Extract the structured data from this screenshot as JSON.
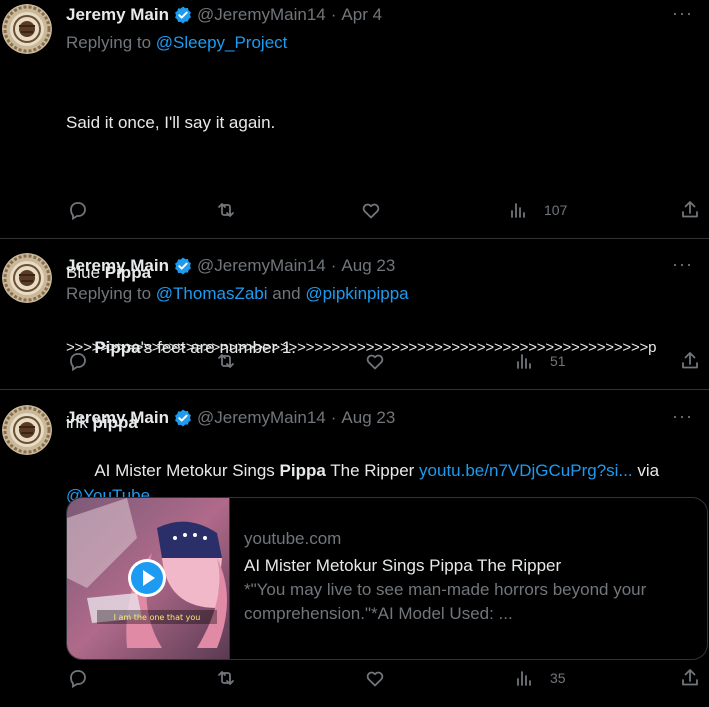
{
  "tweets": [
    {
      "name": "Jeremy Main",
      "handle": "@JeremyMain14",
      "date": "Apr 4",
      "replying_prefix": "Replying to ",
      "replying_to": "@Sleepy_Project",
      "text": {
        "line1": "Said it once, I'll say it again.",
        "blue_prefix": "Blue ",
        "blue_bold": "Pippa",
        "arrows": ">>>>>>>>>>>>>>>>>>>>>>>>>>>>>>>>>>>>>>>>>>>>>>>>>>>>>>>>>>>>>>>>>>>>p",
        "ink_prefix": "ink ",
        "ink_bold": "pippa"
      },
      "views": "107"
    },
    {
      "name": "Jeremy Main",
      "handle": "@JeremyMain14",
      "date": "Aug 23",
      "replying_prefix": "Replying to ",
      "replying_to_1": "@ThomasZabi",
      "replying_and": " and ",
      "replying_to_2": "@pipkinpippa",
      "text": {
        "bold": "Pippa",
        "rest": "'s feet are number 1."
      },
      "views": "51"
    },
    {
      "name": "Jeremy Main",
      "handle": "@JeremyMain14",
      "date": "Aug 23",
      "text": {
        "prefix": "AI Mister Metokur Sings ",
        "bold": "Pippa",
        "suffix": " The Ripper ",
        "link": "youtu.be/n7VDjGCuPrg?si...",
        "via": " via",
        "mention": "@YouTube"
      },
      "card": {
        "domain": "youtube.com",
        "title": "AI Mister Metokur Sings Pippa The Ripper",
        "description": "*\"You may live to see man-made horrors beyond your comprehension.\"*AI Model Used: ...",
        "thumb_caption": "I am the one that you"
      },
      "views": "35"
    }
  ],
  "ui": {
    "more": "···",
    "sep": "·"
  },
  "colors": {
    "background": "#000000",
    "text": "#e7e9ea",
    "muted": "#71767b",
    "link": "#1d9bf0",
    "border": "#2f3336",
    "verified": "#1d9bf0"
  },
  "icons": [
    "verified-badge-icon",
    "reply-icon",
    "retweet-icon",
    "like-icon",
    "views-icon",
    "share-icon",
    "more-icon",
    "play-icon"
  ]
}
